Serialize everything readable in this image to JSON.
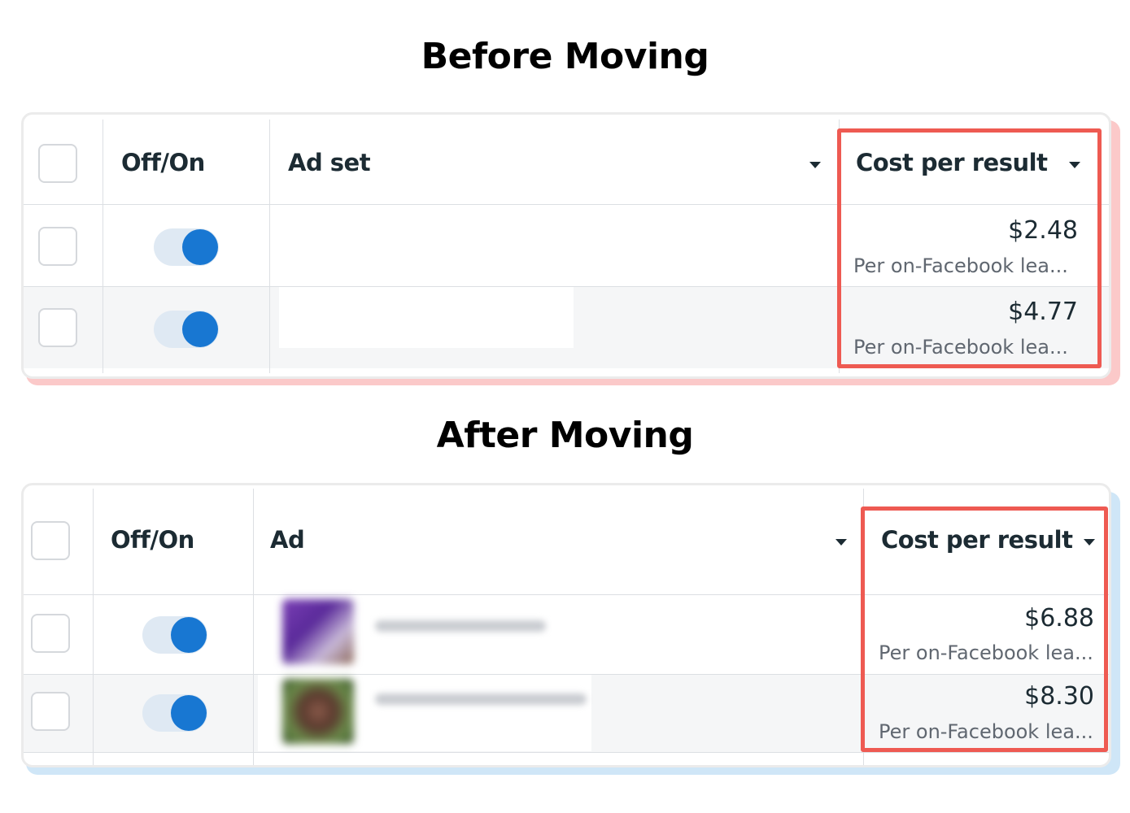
{
  "before": {
    "title": "Before Moving",
    "columns": {
      "offon": "Off/On",
      "name": "Ad set",
      "cost": "Cost per result"
    },
    "rows": [
      {
        "toggle_on": true,
        "amount": "$2.48",
        "sub": "Per on-Facebook lea..."
      },
      {
        "toggle_on": true,
        "amount": "$4.77",
        "sub": "Per on-Facebook lea..."
      }
    ]
  },
  "after": {
    "title": "After Moving",
    "columns": {
      "offon": "Off/On",
      "name": "Ad",
      "cost": "Cost per result"
    },
    "rows": [
      {
        "toggle_on": true,
        "amount": "$6.88",
        "sub": "Per on-Facebook lea..."
      },
      {
        "toggle_on": true,
        "amount": "$8.30",
        "sub": "Per on-Facebook lea..."
      }
    ]
  },
  "colors": {
    "highlight": "#ee5a52",
    "toggle_on": "#1877d2",
    "before_shadow": "#fbc9c9",
    "after_shadow": "#cfe6f7"
  }
}
